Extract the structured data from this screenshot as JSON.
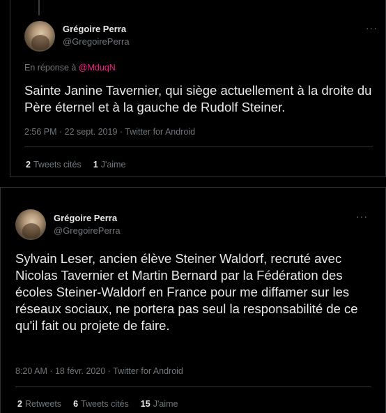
{
  "tweet1": {
    "name": "Grégoire Perra",
    "handle": "@GregoirePerra",
    "more": "···",
    "reply_prefix": "En réponse à ",
    "reply_mention": "@MduqN",
    "text": "Sainte Janine Tavernier, qui siège actuellement à la droite du Père éternel et à la gauche de Rudolf Steiner.",
    "meta": "2:56 PM · 22 sept. 2019 · Twitter for Android",
    "stats": {
      "quotes_count": "2",
      "quotes_label": "Tweets cités",
      "likes_count": "1",
      "likes_label": "J'aime"
    }
  },
  "tweet2": {
    "name": "Grégoire Perra",
    "handle": "@GregoirePerra",
    "more": "···",
    "text": "Sylvain Leser, ancien élève Steiner Waldorf,  recruté avec Nicolas Tavernier et Martin Bernard par la Fédération des écoles Steiner-Waldorf en France pour me diffamer sur les réseaux sociaux,  ne portera pas seul la responsabilité de ce qu'il fait ou projete de faire.",
    "meta": "8:20 AM · 18 févr. 2020 · Twitter for Android",
    "stats": {
      "retweets_count": "2",
      "retweets_label": "Retweets",
      "quotes_count": "6",
      "quotes_label": "Tweets cités",
      "likes_count": "15",
      "likes_label": "J'aime"
    }
  },
  "colors": {
    "background": "#000000",
    "text": "#e7e9ea",
    "secondary": "#71767b",
    "mention": "#f91880",
    "border": "#2f3336"
  }
}
